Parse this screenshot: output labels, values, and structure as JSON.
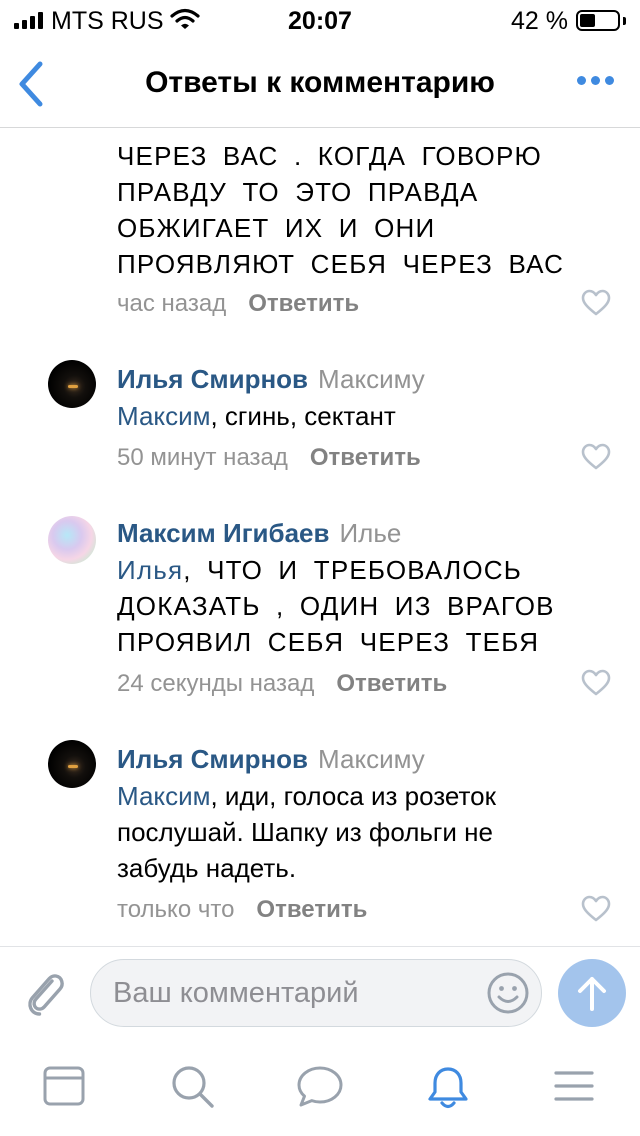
{
  "status_bar": {
    "carrier": "MTS RUS",
    "time": "20:07",
    "battery_percent": "42 %",
    "battery_level": 0.42
  },
  "nav": {
    "title": "Ответы к комментарию"
  },
  "comments": [
    {
      "text": "ЧЕРЕЗ ВАС . КОГДА ГОВОРЮ ПРАВДУ ТО ЭТО ПРАВДА ОБЖИГАЕТ ИХ И ОНИ ПРОЯВЛЯЮТ СЕБЯ ЧЕРЕЗ ВАС",
      "time": "час назад",
      "reply_label": "Ответить"
    },
    {
      "author": "Илья Смирнов",
      "reply_to": "Максиму",
      "mention": "Максим",
      "text": ", сгинь, сектант",
      "time": "50 минут назад",
      "reply_label": "Ответить"
    },
    {
      "author": "Максим Игибаев",
      "reply_to": "Илье",
      "mention": "Илья",
      "text": ", ЧТО И ТРЕБОВАЛОСЬ ДОКАЗАТЬ , ОДИН ИЗ ВРАГОВ ПРОЯВИЛ СЕБЯ ЧЕРЕЗ ТЕБЯ",
      "time": "24 секунды назад",
      "reply_label": "Ответить"
    },
    {
      "author": "Илья Смирнов",
      "reply_to": "Максиму",
      "mention": "Максим",
      "text": ", иди, голоса из розеток послушай. Шапку из фольги не забудь надеть.",
      "time": "только что",
      "reply_label": "Ответить"
    }
  ],
  "composer": {
    "placeholder": "Ваш комментарий"
  },
  "colors": {
    "accent": "#3f8ae0",
    "author_link": "#2a5885",
    "secondary_text": "#939393",
    "send_button": "#a3c4ec"
  },
  "icons": {
    "back": "chevron-left-icon",
    "more": "more-dots-icon",
    "like": "heart-outline-icon",
    "attach": "paperclip-icon",
    "emoji": "smile-icon",
    "send": "arrow-up-icon",
    "tabs": [
      "news-icon",
      "search-icon",
      "messages-icon",
      "notifications-icon",
      "menu-icon"
    ]
  },
  "tabs": {
    "active_index": 3
  }
}
